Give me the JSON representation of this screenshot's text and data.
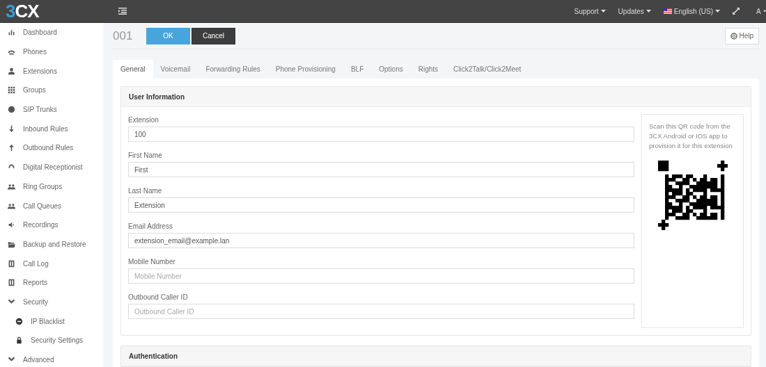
{
  "topbar": {
    "logo": "3CX",
    "menus": [
      {
        "label": "Support",
        "flag": false
      },
      {
        "label": "Updates",
        "flag": false
      },
      {
        "label": "English (US)",
        "flag": true
      }
    ],
    "user": "A"
  },
  "sidebar": {
    "items": [
      {
        "label": "Dashboard"
      },
      {
        "label": "Phones"
      },
      {
        "label": "Extensions"
      },
      {
        "label": "Groups"
      },
      {
        "label": "SIP Trunks"
      },
      {
        "label": "Inbound Rules"
      },
      {
        "label": "Outbound Rules"
      },
      {
        "label": "Digital Receptionist"
      },
      {
        "label": "Ring Groups"
      },
      {
        "label": "Call Queues"
      },
      {
        "label": "Recordings"
      },
      {
        "label": "Backup and Restore"
      },
      {
        "label": "Call Log"
      },
      {
        "label": "Reports"
      },
      {
        "label": "Security",
        "expanded": true,
        "children": [
          {
            "label": "IP Blacklist"
          },
          {
            "label": "Security Settings"
          }
        ]
      },
      {
        "label": "Advanced",
        "expanded": true
      }
    ]
  },
  "header": {
    "title": "001",
    "buttons": [
      {
        "label": "OK",
        "kind": "primary"
      },
      {
        "label": "Cancel",
        "kind": "dark"
      }
    ],
    "help": "Help"
  },
  "tabs": [
    {
      "label": "General",
      "selected": true
    },
    {
      "label": "Voicemail",
      "selected": false
    },
    {
      "label": "Forwarding Rules",
      "selected": false
    },
    {
      "label": "Phone Provisioning",
      "selected": false
    },
    {
      "label": "BLF",
      "selected": false
    },
    {
      "label": "Options",
      "selected": false
    },
    {
      "label": "Rights",
      "selected": false
    },
    {
      "label": "Click2Talk/Click2Meet",
      "selected": false
    }
  ],
  "user_information": {
    "title": "User Information",
    "fields": [
      {
        "label": "Extension",
        "value": "100"
      },
      {
        "label": "First Name",
        "value": "First"
      },
      {
        "label": "Last Name",
        "value": "Extension"
      },
      {
        "label": "Email Address",
        "value": "extension_email@example.lan"
      },
      {
        "label": "Mobile Number",
        "placeholder": "Mobile Number"
      },
      {
        "label": "Outbound Caller ID",
        "placeholder": "Outbound Caller ID"
      }
    ],
    "qr_hint": "Scan this QR code from the 3CX Android or IOS app to provision it for this extension"
  },
  "authentication": {
    "title": "Authentication"
  }
}
